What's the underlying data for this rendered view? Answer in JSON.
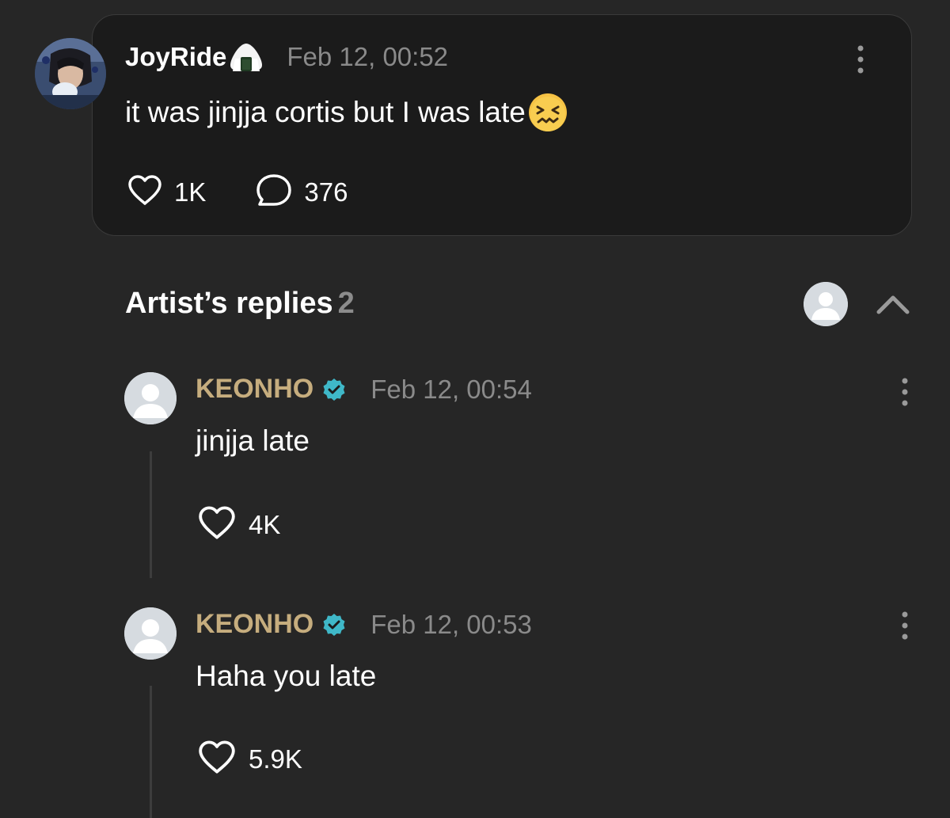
{
  "post": {
    "username": "JoyRide",
    "username_emoji": "rice-ball-icon",
    "timestamp": "Feb 12, 00:52",
    "text": "it was jinjja cortis but I was late",
    "text_emoji": "confounded-face-icon",
    "likes": "1K",
    "comments": "376"
  },
  "artist_replies": {
    "title": "Artist’s replies",
    "count": "2"
  },
  "replies": [
    {
      "author": "KEONHO",
      "timestamp": "Feb 12, 00:54",
      "text": "jinjja late",
      "likes": "4K"
    },
    {
      "author": "KEONHO",
      "timestamp": "Feb 12, 00:53",
      "text": "Haha you late",
      "likes": "5.9K"
    }
  ],
  "colors": {
    "background": "#262626",
    "card": "#1b1b1b",
    "artist_name": "#c6ad7e",
    "verified": "#3fb8c8",
    "muted_text": "#8a8a8a"
  }
}
